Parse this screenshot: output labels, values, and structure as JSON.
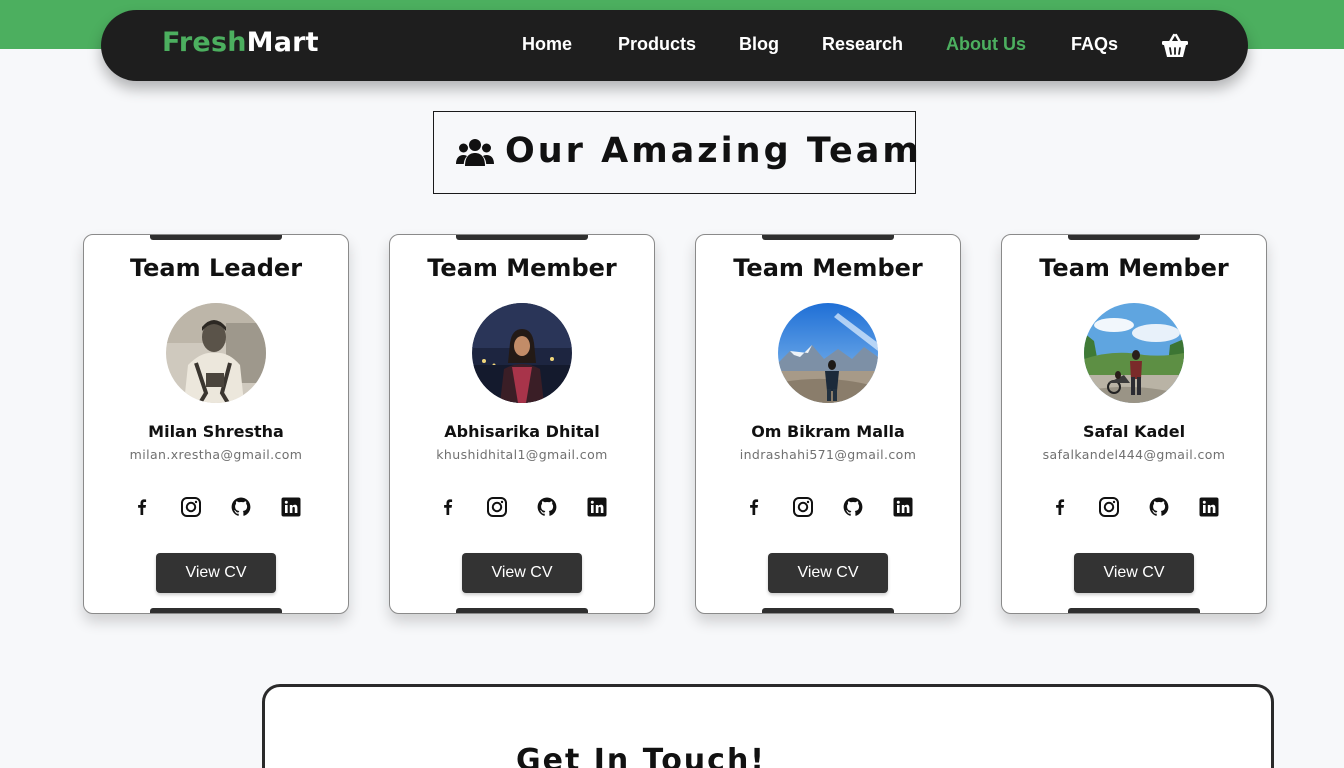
{
  "brand": {
    "part1": "Fresh",
    "part2": "Mart",
    "accent": "#4caf5f",
    "dark": "#1e1e1e"
  },
  "nav": {
    "items": [
      {
        "label": "Home"
      },
      {
        "label": "Products"
      },
      {
        "label": "Blog"
      },
      {
        "label": "Research"
      },
      {
        "label": "About Us",
        "active": true
      },
      {
        "label": "FAQs"
      }
    ],
    "cart_icon": "shopping-basket-icon"
  },
  "section": {
    "title": "Our Amazing Team",
    "icon": "users-icon"
  },
  "team": [
    {
      "role": "Team Leader",
      "name": "Milan Shrestha",
      "email": "milan.xrestha@gmail.com",
      "photo": "vintage-sepia-portrait",
      "cv_label": "View CV"
    },
    {
      "role": "Team Member",
      "name": "Abhisarika Dhital",
      "email": "khushidhital1@gmail.com",
      "photo": "night-city-portrait",
      "cv_label": "View CV"
    },
    {
      "role": "Team Member",
      "name": "Om Bikram Malla",
      "email": "indrashahi571@gmail.com",
      "photo": "mountain-blue-sky-portrait",
      "cv_label": "View CV"
    },
    {
      "role": "Team Member",
      "name": "Safal Kadel",
      "email": "safalkandel444@gmail.com",
      "photo": "forest-road-portrait",
      "cv_label": "View CV"
    }
  ],
  "social_icons": [
    "facebook-icon",
    "instagram-icon",
    "github-icon",
    "linkedin-icon"
  ],
  "contact": {
    "title": "Get In Touch!"
  }
}
